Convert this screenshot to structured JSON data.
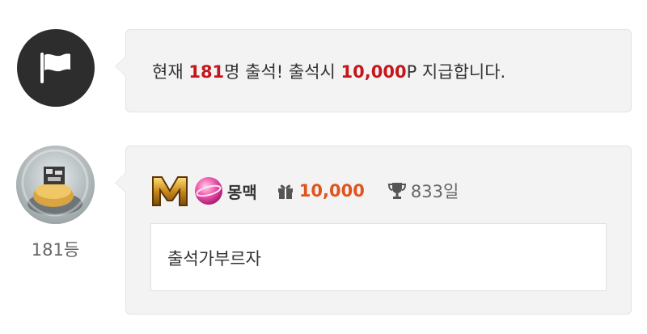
{
  "notice": {
    "icon": "flag-icon",
    "prefix": "현재 ",
    "count": "181",
    "mid": "명 출석! 출석시 ",
    "reward": "10,000",
    "suffix": "P 지급합니다.",
    "highlight_color": "#c4161c"
  },
  "entry": {
    "rank": "181등",
    "level_badge": "M",
    "nickname": "몽맥",
    "points": "10,000",
    "points_color": "#e0541e",
    "days": "833일",
    "comment": "출석가부르자"
  }
}
